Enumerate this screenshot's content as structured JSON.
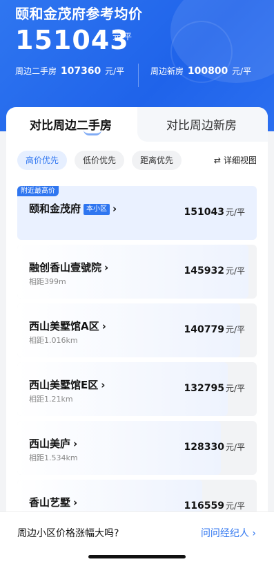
{
  "header": {
    "title": "颐和金茂府参考均价",
    "price": "151043",
    "unit": "元/平",
    "stat_secondhand_label": "周边二手房",
    "stat_secondhand_value": "107360",
    "stat_secondhand_unit": "元/平",
    "stat_new_label": "周边新房",
    "stat_new_value": "100800",
    "stat_new_unit": "元/平"
  },
  "tabs": [
    {
      "label": "对比周边二手房",
      "active": true
    },
    {
      "label": "对比周边新房",
      "active": false
    }
  ],
  "filters": {
    "chips": [
      "高价优先",
      "低价优先",
      "距离优先"
    ],
    "active_index": 0,
    "detail_icon": "swap-icon",
    "detail_label": "详细视图"
  },
  "rows": [
    {
      "name": "颐和金茂府",
      "tag": "附近最高价",
      "badge": "本小区",
      "distance": "",
      "price": "151043",
      "unit": "元/平",
      "fill": 1.0
    },
    {
      "name": "融创香山壹號院",
      "tag": "",
      "badge": "",
      "distance": "相距399m",
      "price": "145932",
      "unit": "元/平",
      "fill": 0.966
    },
    {
      "name": "西山美墅馆A区",
      "tag": "",
      "badge": "",
      "distance": "相距1.016km",
      "price": "140779",
      "unit": "元/平",
      "fill": 0.932
    },
    {
      "name": "西山美墅馆E区",
      "tag": "",
      "badge": "",
      "distance": "相距1.21km",
      "price": "132795",
      "unit": "元/平",
      "fill": 0.879
    },
    {
      "name": "西山美庐",
      "tag": "",
      "badge": "",
      "distance": "相距1.534km",
      "price": "128330",
      "unit": "元/平",
      "fill": 0.85
    },
    {
      "name": "香山艺墅",
      "tag": "",
      "badge": "",
      "distance": "",
      "price": "116559",
      "unit": "元/平",
      "fill": 0.772
    }
  ],
  "bottom": {
    "question": "周边小区价格涨幅大吗?",
    "link": "问问经纪人"
  },
  "colors": {
    "accent": "#2f76f0",
    "header_bg": "#1f63ea"
  }
}
